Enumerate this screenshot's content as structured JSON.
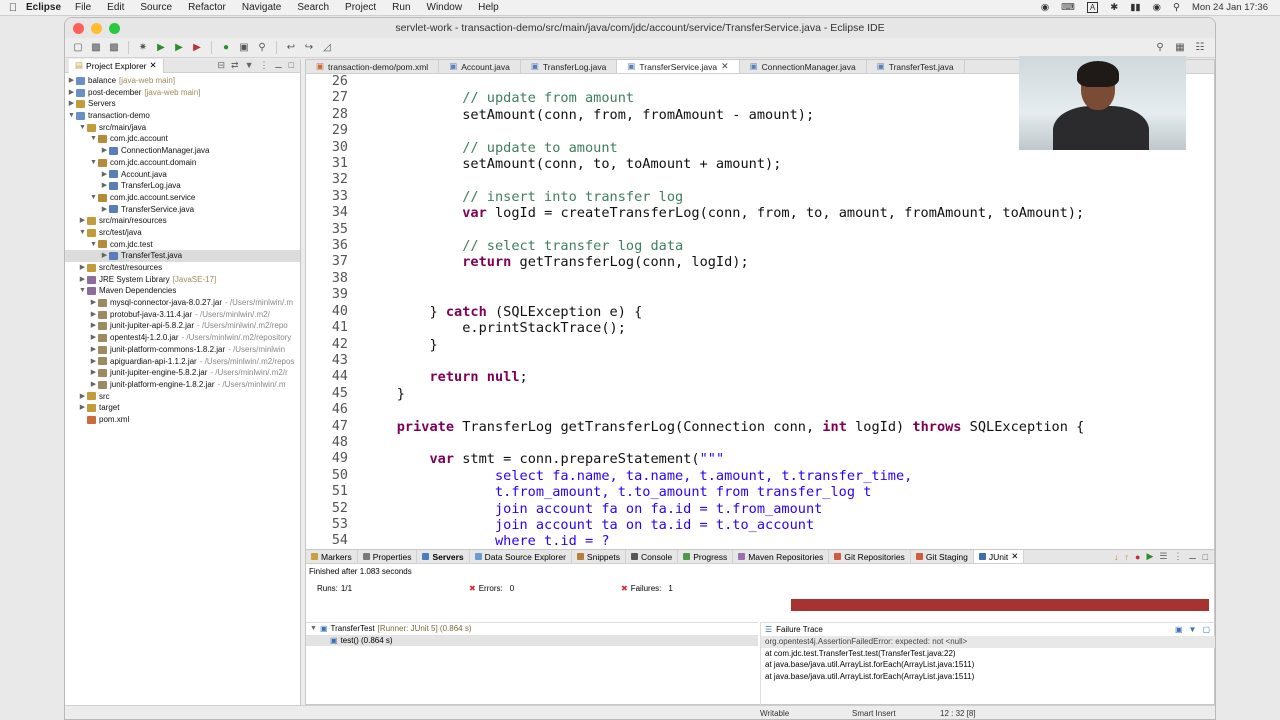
{
  "menubar": {
    "app_name": "Eclipse",
    "items": [
      "File",
      "Edit",
      "Source",
      "Refactor",
      "Navigate",
      "Search",
      "Project",
      "Run",
      "Window",
      "Help"
    ],
    "status": {
      "datetime": "Mon 24 Jan  17:36",
      "input_letter": "A"
    }
  },
  "window": {
    "title": "servlet-work - transaction-demo/src/main/java/com/jdc/account/service/TransferService.java - Eclipse IDE"
  },
  "explorer": {
    "tab_label": "Project Explorer",
    "rows": [
      {
        "label": "balance",
        "extra": "[java-web main]"
      },
      {
        "label": "post-december",
        "extra": "[java-web main]"
      },
      {
        "label": "Servers",
        "extra": ""
      },
      {
        "label": "transaction-demo",
        "extra": ""
      },
      {
        "label": "src/main/java",
        "extra": ""
      },
      {
        "label": "com.jdc.account",
        "extra": ""
      },
      {
        "label": "ConnectionManager.java",
        "extra": ""
      },
      {
        "label": "com.jdc.account.domain",
        "extra": ""
      },
      {
        "label": "Account.java",
        "extra": ""
      },
      {
        "label": "TransferLog.java",
        "extra": ""
      },
      {
        "label": "com.jdc.account.service",
        "extra": ""
      },
      {
        "label": "TransferService.java",
        "extra": ""
      },
      {
        "label": "src/main/resources",
        "extra": ""
      },
      {
        "label": "src/test/java",
        "extra": ""
      },
      {
        "label": "com.jdc.test",
        "extra": ""
      },
      {
        "label": "TransferTest.java",
        "extra": ""
      },
      {
        "label": "src/test/resources",
        "extra": ""
      },
      {
        "label": "JRE System Library",
        "extra": "[JavaSE-17]"
      },
      {
        "label": "Maven Dependencies",
        "extra": ""
      },
      {
        "label": "mysql-connector-java-8.0.27.jar",
        "extra": "- /Users/minlwin/.m"
      },
      {
        "label": "protobuf-java-3.11.4.jar",
        "extra": "- /Users/minlwin/.m2/"
      },
      {
        "label": "junit-jupiter-api-5.8.2.jar",
        "extra": "- /Users/minlwin/.m2/repo"
      },
      {
        "label": "opentest4j-1.2.0.jar",
        "extra": "- /Users/minlwin/.m2/repository"
      },
      {
        "label": "junit-platform-commons-1.8.2.jar",
        "extra": "- /Users/minlwin"
      },
      {
        "label": "apiguardian-api-1.1.2.jar",
        "extra": "- /Users/minlwin/.m2/repos"
      },
      {
        "label": "junit-jupiter-engine-5.8.2.jar",
        "extra": "- /Users/minlwin/.m2/r"
      },
      {
        "label": "junit-platform-engine-1.8.2.jar",
        "extra": "- /Users/minlwin/.m"
      },
      {
        "label": "src",
        "extra": ""
      },
      {
        "label": "target",
        "extra": ""
      },
      {
        "label": "pom.xml",
        "extra": ""
      }
    ]
  },
  "editor": {
    "tabs": [
      "transaction-demo/pom.xml",
      "Account.java",
      "TransferLog.java",
      "TransferService.java",
      "ConnectionManager.java",
      "TransferTest.java"
    ],
    "lines": [
      {
        "n": "26",
        "t": ""
      },
      {
        "n": "27",
        "t": "            // update from amount"
      },
      {
        "n": "28",
        "t": "            setAmount(conn, from, fromAmount - amount);"
      },
      {
        "n": "29",
        "t": ""
      },
      {
        "n": "30",
        "t": "            // update to amount"
      },
      {
        "n": "31",
        "t": "            setAmount(conn, to, toAmount + amount);"
      },
      {
        "n": "32",
        "t": ""
      },
      {
        "n": "33",
        "t": "            // insert into transfer log"
      },
      {
        "n": "34",
        "t": "            var logId = createTransferLog(conn, from, to, amount, fromAmount, toAmount);"
      },
      {
        "n": "35",
        "t": ""
      },
      {
        "n": "36",
        "t": "            // select transfer log data"
      },
      {
        "n": "37",
        "t": "            return getTransferLog(conn, logId);"
      },
      {
        "n": "38",
        "t": ""
      },
      {
        "n": "39",
        "t": ""
      },
      {
        "n": "40",
        "t": "        } catch (SQLException e) {"
      },
      {
        "n": "41",
        "t": "            e.printStackTrace();"
      },
      {
        "n": "42",
        "t": "        }"
      },
      {
        "n": "43",
        "t": ""
      },
      {
        "n": "44",
        "t": "        return null;"
      },
      {
        "n": "45",
        "t": "    }"
      },
      {
        "n": "46",
        "t": ""
      },
      {
        "n": "47",
        "t": "    private TransferLog getTransferLog(Connection conn, int logId) throws SQLException {"
      },
      {
        "n": "48",
        "t": ""
      },
      {
        "n": "49",
        "t": "        var stmt = conn.prepareStatement(\"\"\""
      },
      {
        "n": "50",
        "t": "                select fa.name, ta.name, t.amount, t.transfer_time,"
      },
      {
        "n": "51",
        "t": "                t.from_amount, t.to_amount from transfer_log t"
      },
      {
        "n": "52",
        "t": "                join account fa on fa.id = t.from_amount"
      },
      {
        "n": "53",
        "t": "                join account ta on ta.id = t.to_account"
      },
      {
        "n": "54",
        "t": "                where t.id = ?"
      }
    ]
  },
  "bottom": {
    "tabs": [
      "Markers",
      "Properties",
      "Servers",
      "Data Source Explorer",
      "Snippets",
      "Console",
      "Progress",
      "Maven Repositories",
      "Git Repositories",
      "Git Staging",
      "JUnit"
    ],
    "finished": "Finished after 1.083 seconds",
    "runs_label": "Runs:",
    "runs_value": "1/1",
    "errors_label": "Errors:",
    "errors_value": "0",
    "failures_label": "Failures:",
    "failures_value": "1",
    "tests": [
      {
        "name": "TransferTest",
        "meta": "[Runner: JUnit 5] (0.864 s)"
      },
      {
        "name": "test() (0.864 s)",
        "meta": ""
      }
    ],
    "trace_title": "Failure Trace",
    "trace": [
      "org.opentest4j.AssertionFailedError: expected: not <null>",
      "at com.jdc.test.TransferTest.test(TransferTest.java:22)",
      "at java.base/java.util.ArrayList.forEach(ArrayList.java:1511)",
      "at java.base/java.util.ArrayList.forEach(ArrayList.java:1511)"
    ]
  },
  "statusbar": {
    "writable": "Writable",
    "insert_mode": "Smart Insert",
    "position": "12 : 32 [8]"
  },
  "colors": {
    "failure_bar": "#a83131",
    "keyword": "#7f0055",
    "comment": "#3f7f5f"
  }
}
